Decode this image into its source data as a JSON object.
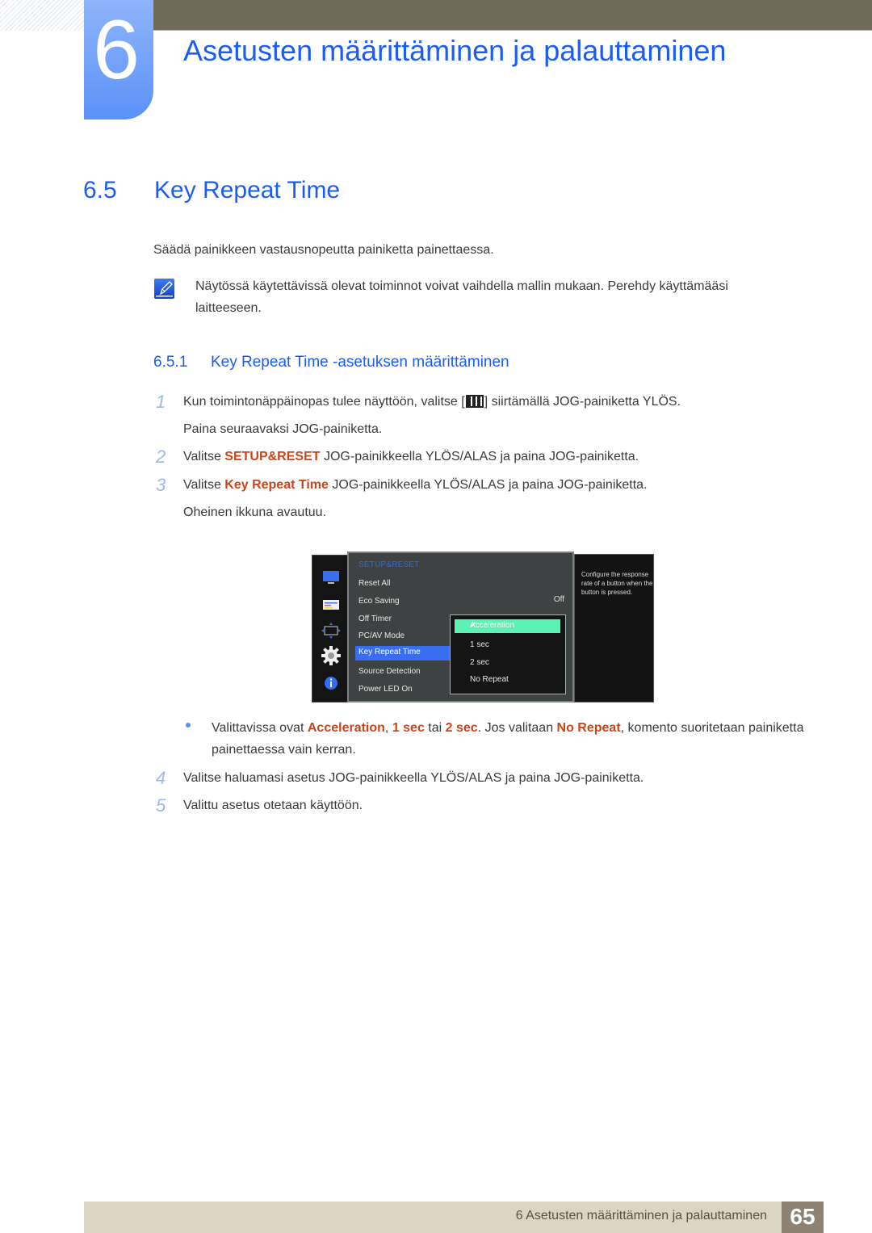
{
  "header": {
    "chapter_number": "6",
    "chapter_title": "Asetusten määrittäminen ja palauttaminen"
  },
  "section": {
    "number": "6.5",
    "title": "Key Repeat Time",
    "intro": "Säädä painikkeen vastausnopeutta painiketta painettaessa.",
    "note": "Näytössä käytettävissä olevat toiminnot voivat vaihdella mallin mukaan. Perehdy käyttämääsi laitteeseen."
  },
  "subsection": {
    "number": "6.5.1",
    "title": "Key Repeat Time -asetuksen määrittäminen"
  },
  "steps": [
    {
      "num": "1",
      "a": "Kun toimintonäppäinopas tulee näyttöön, valitse [",
      "b": "] siirtämällä JOG-painiketta YLÖS.",
      "c": "Paina seuraavaksi JOG-painiketta."
    },
    {
      "num": "2",
      "a": "Valitse ",
      "hl": "SETUP&RESET",
      "b": " JOG-painikkeella YLÖS/ALAS ja paina JOG-painiketta."
    },
    {
      "num": "3",
      "a": "Valitse ",
      "hl": "Key Repeat Time",
      "b": " JOG-painikkeella YLÖS/ALAS ja paina JOG-painiketta.",
      "c": "Oheinen ikkuna avautuu."
    },
    {
      "num": "4",
      "a": "Valitse haluamasi asetus JOG-painikkeella YLÖS/ALAS ja paina JOG-painiketta."
    },
    {
      "num": "5",
      "a": "Valittu asetus otetaan käyttöön."
    }
  ],
  "bullet": {
    "t1": "Valittavissa ovat ",
    "h1": "Acceleration",
    "t2": ", ",
    "h2": "1 sec",
    "t3": " tai ",
    "h3": "2 sec",
    "t4": ". Jos valitaan ",
    "h4": "No Repeat",
    "t5": ", komento suoritetaan painiketta painettaessa vain kerran."
  },
  "osd": {
    "title": "SETUP&RESET",
    "items": [
      "Reset All",
      "Eco Saving",
      "Off Timer",
      "PC/AV Mode",
      "Key Repeat Time",
      "Source Detection",
      "Power LED On"
    ],
    "selected": "Key Repeat Time",
    "eco_saving_value": "Off",
    "submenu": [
      "Acceleration",
      "1 sec",
      "2 sec",
      "No Repeat"
    ],
    "submenu_selected": "Acceleration",
    "help": "Configure the response rate of a button when the button is pressed.",
    "side_icons": [
      "monitor-icon",
      "picture-settings-icon",
      "position-icon",
      "gear-icon",
      "info-icon"
    ]
  },
  "footer": {
    "text": "6 Asetusten määrittäminen ja palauttaminen",
    "page": "65"
  }
}
